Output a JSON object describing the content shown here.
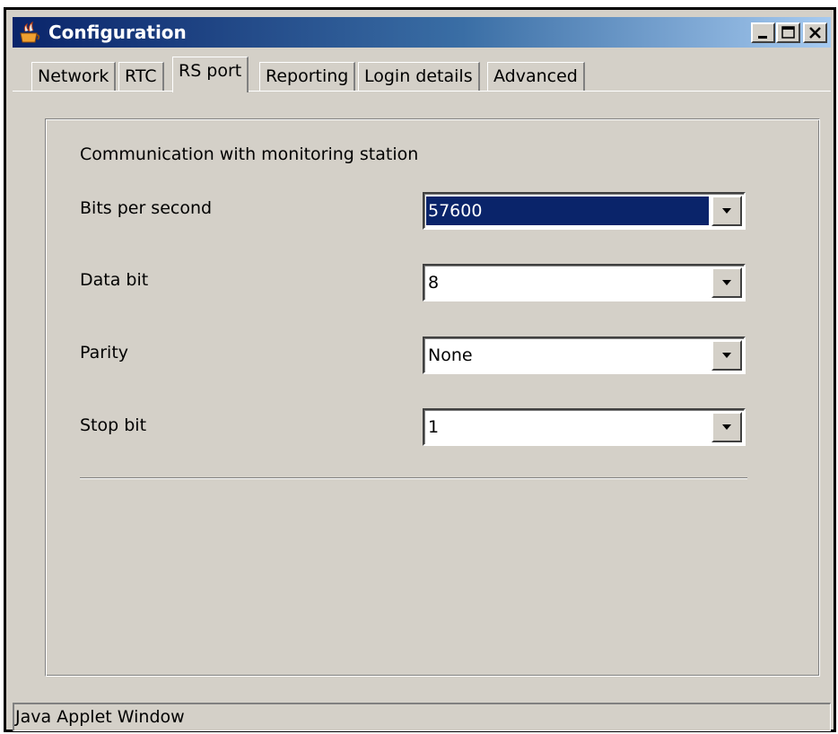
{
  "window": {
    "title": "Configuration",
    "icon": "java-cup-icon",
    "controls": [
      "minimize-icon",
      "maximize-icon",
      "close-icon"
    ]
  },
  "tabs": [
    {
      "label": "Network",
      "active": false
    },
    {
      "label": "RTC",
      "active": false
    },
    {
      "label": "RS port",
      "active": true
    },
    {
      "label": "Reporting",
      "active": false
    },
    {
      "label": "Login details",
      "active": false
    },
    {
      "label": "Advanced",
      "active": false
    }
  ],
  "rs_port": {
    "section_title": "Communication with monitoring station",
    "fields": [
      {
        "label": "Bits per second",
        "value": "57600",
        "focused": true
      },
      {
        "label": "Data bit",
        "value": "8",
        "focused": false
      },
      {
        "label": "Parity",
        "value": "None",
        "focused": false
      },
      {
        "label": "Stop bit",
        "value": "1",
        "focused": false
      }
    ]
  },
  "status_bar": {
    "text": "Java Applet Window"
  },
  "colors": {
    "face": "#d4d0c8",
    "title_start": "#0a246a",
    "title_end": "#a6caf0",
    "selection": "#0a246a"
  }
}
